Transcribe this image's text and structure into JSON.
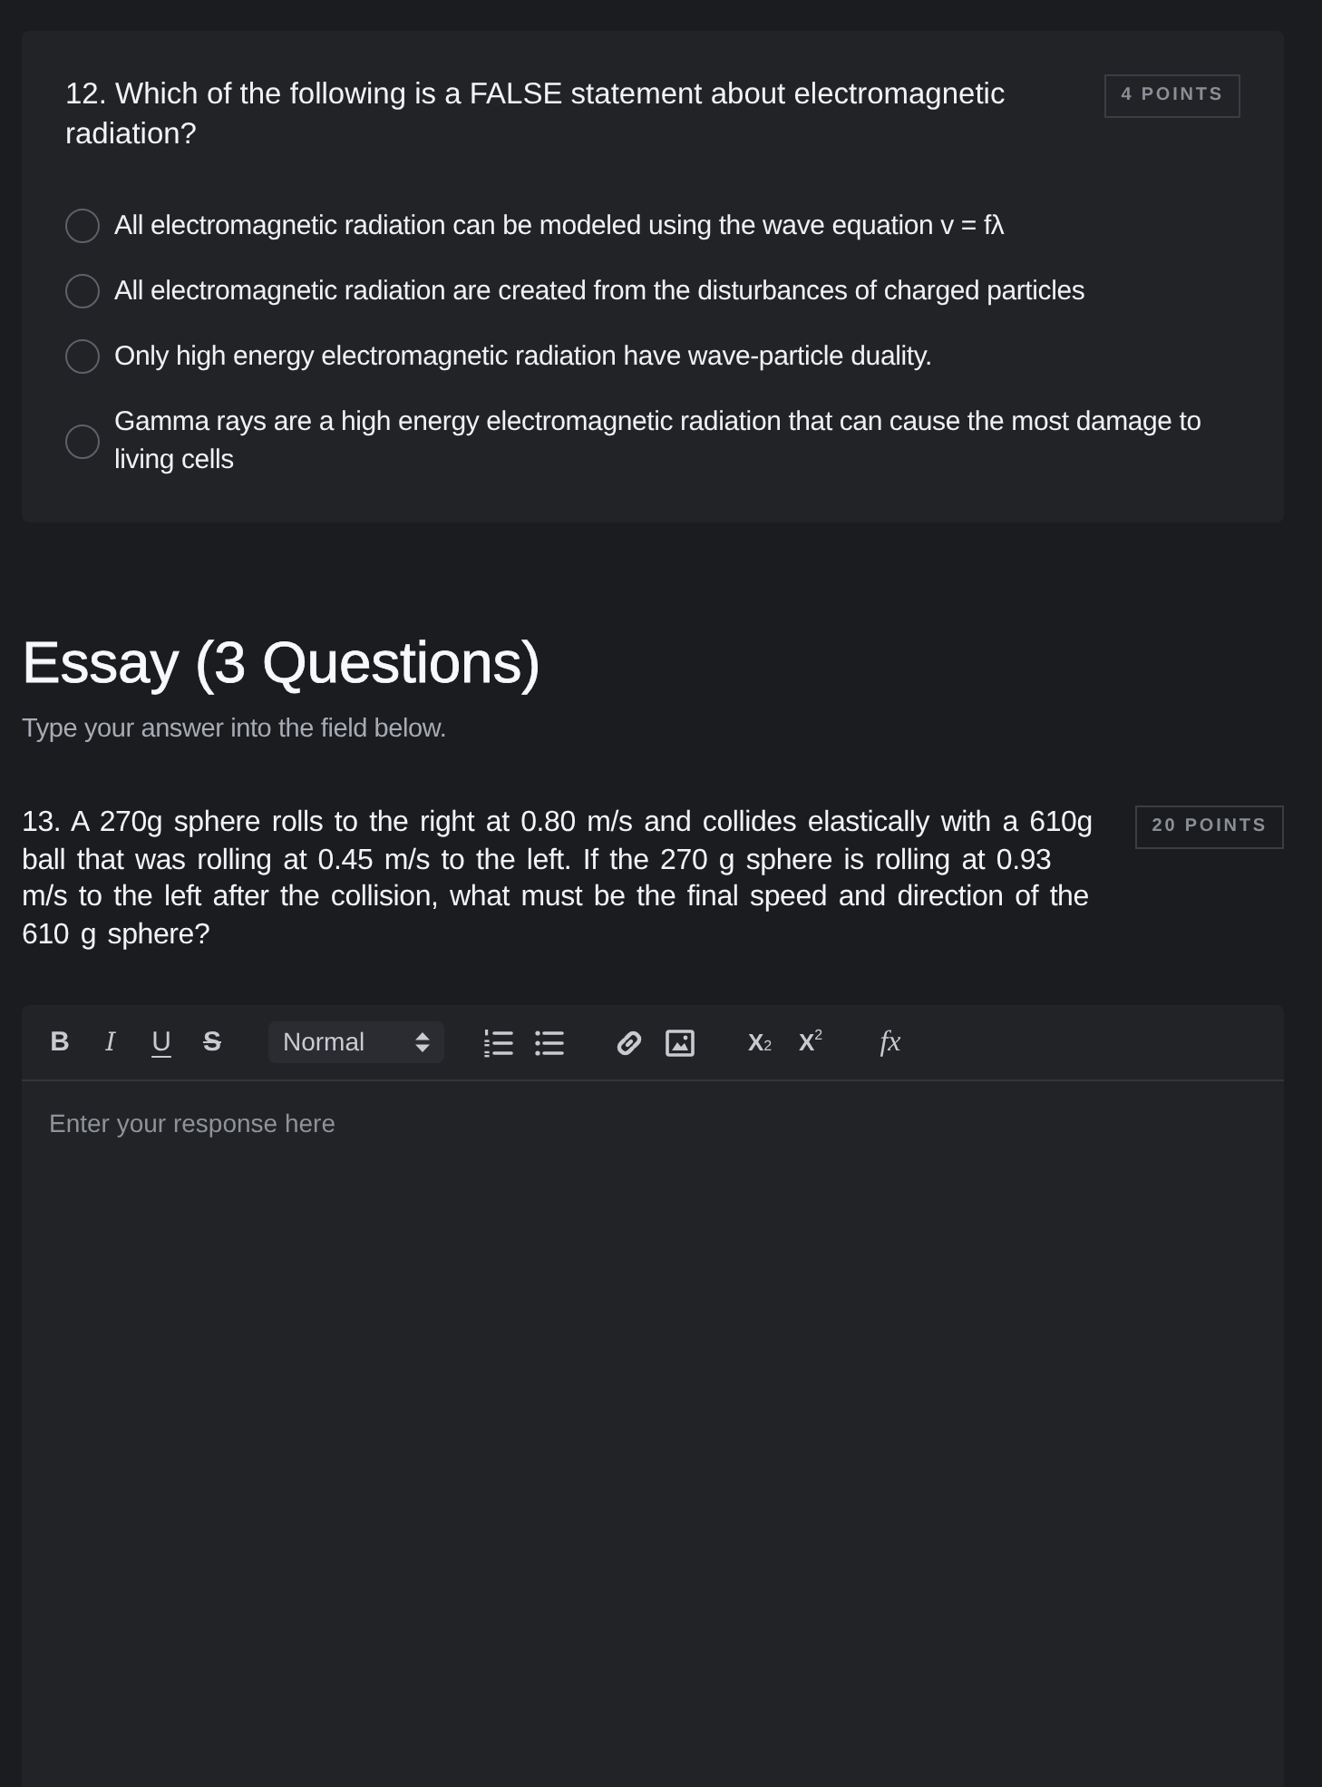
{
  "multiple_choice": {
    "question": "12. Which of the following is a FALSE statement about electromagnetic radiation?",
    "points": "4 POINTS",
    "options": [
      {
        "text": "All electromagnetic radiation can be modeled using the wave equation v = fλ",
        "selected": false
      },
      {
        "text": "All electromagnetic radiation are created from the disturbances of charged particles",
        "selected": false
      },
      {
        "text": "Only high energy electromagnetic radiation have wave-particle duality.",
        "selected": false
      },
      {
        "text": "Gamma rays are a high energy electromagnetic radiation that can cause the most damage to living cells",
        "selected": false
      }
    ]
  },
  "essay_section": {
    "title": "Essay (3 Questions)",
    "instructions": "Type your answer into the field below."
  },
  "essay_question": {
    "question": "13. A 270g sphere rolls to the right at 0.80 m/s and collides elastically with a 610g ball that was rolling at 0.45 m/s to the left. If the 270 g sphere is rolling at 0.93 m/s to the left after the collision, what must be the final speed and direction of the 610 g sphere?",
    "points": "20 POINTS"
  },
  "editor": {
    "toolbar_groups": [
      [
        {
          "kind": "bold",
          "label": "B"
        },
        {
          "kind": "italic",
          "label": "I"
        },
        {
          "kind": "underline",
          "label": "U"
        },
        {
          "kind": "strike",
          "label": "S"
        }
      ],
      [
        {
          "kind": "select",
          "value": "Normal"
        }
      ],
      [
        {
          "kind": "ordered-list"
        },
        {
          "kind": "bullet-list"
        }
      ],
      [
        {
          "kind": "link"
        },
        {
          "kind": "image"
        }
      ],
      [
        {
          "kind": "subscript",
          "label": "X$_{2}$"
        },
        {
          "kind": "superscript",
          "label": "X$^{2}$"
        }
      ],
      [
        {
          "kind": "formula",
          "label": "fx"
        }
      ]
    ],
    "placeholder": "Enter your response here"
  }
}
